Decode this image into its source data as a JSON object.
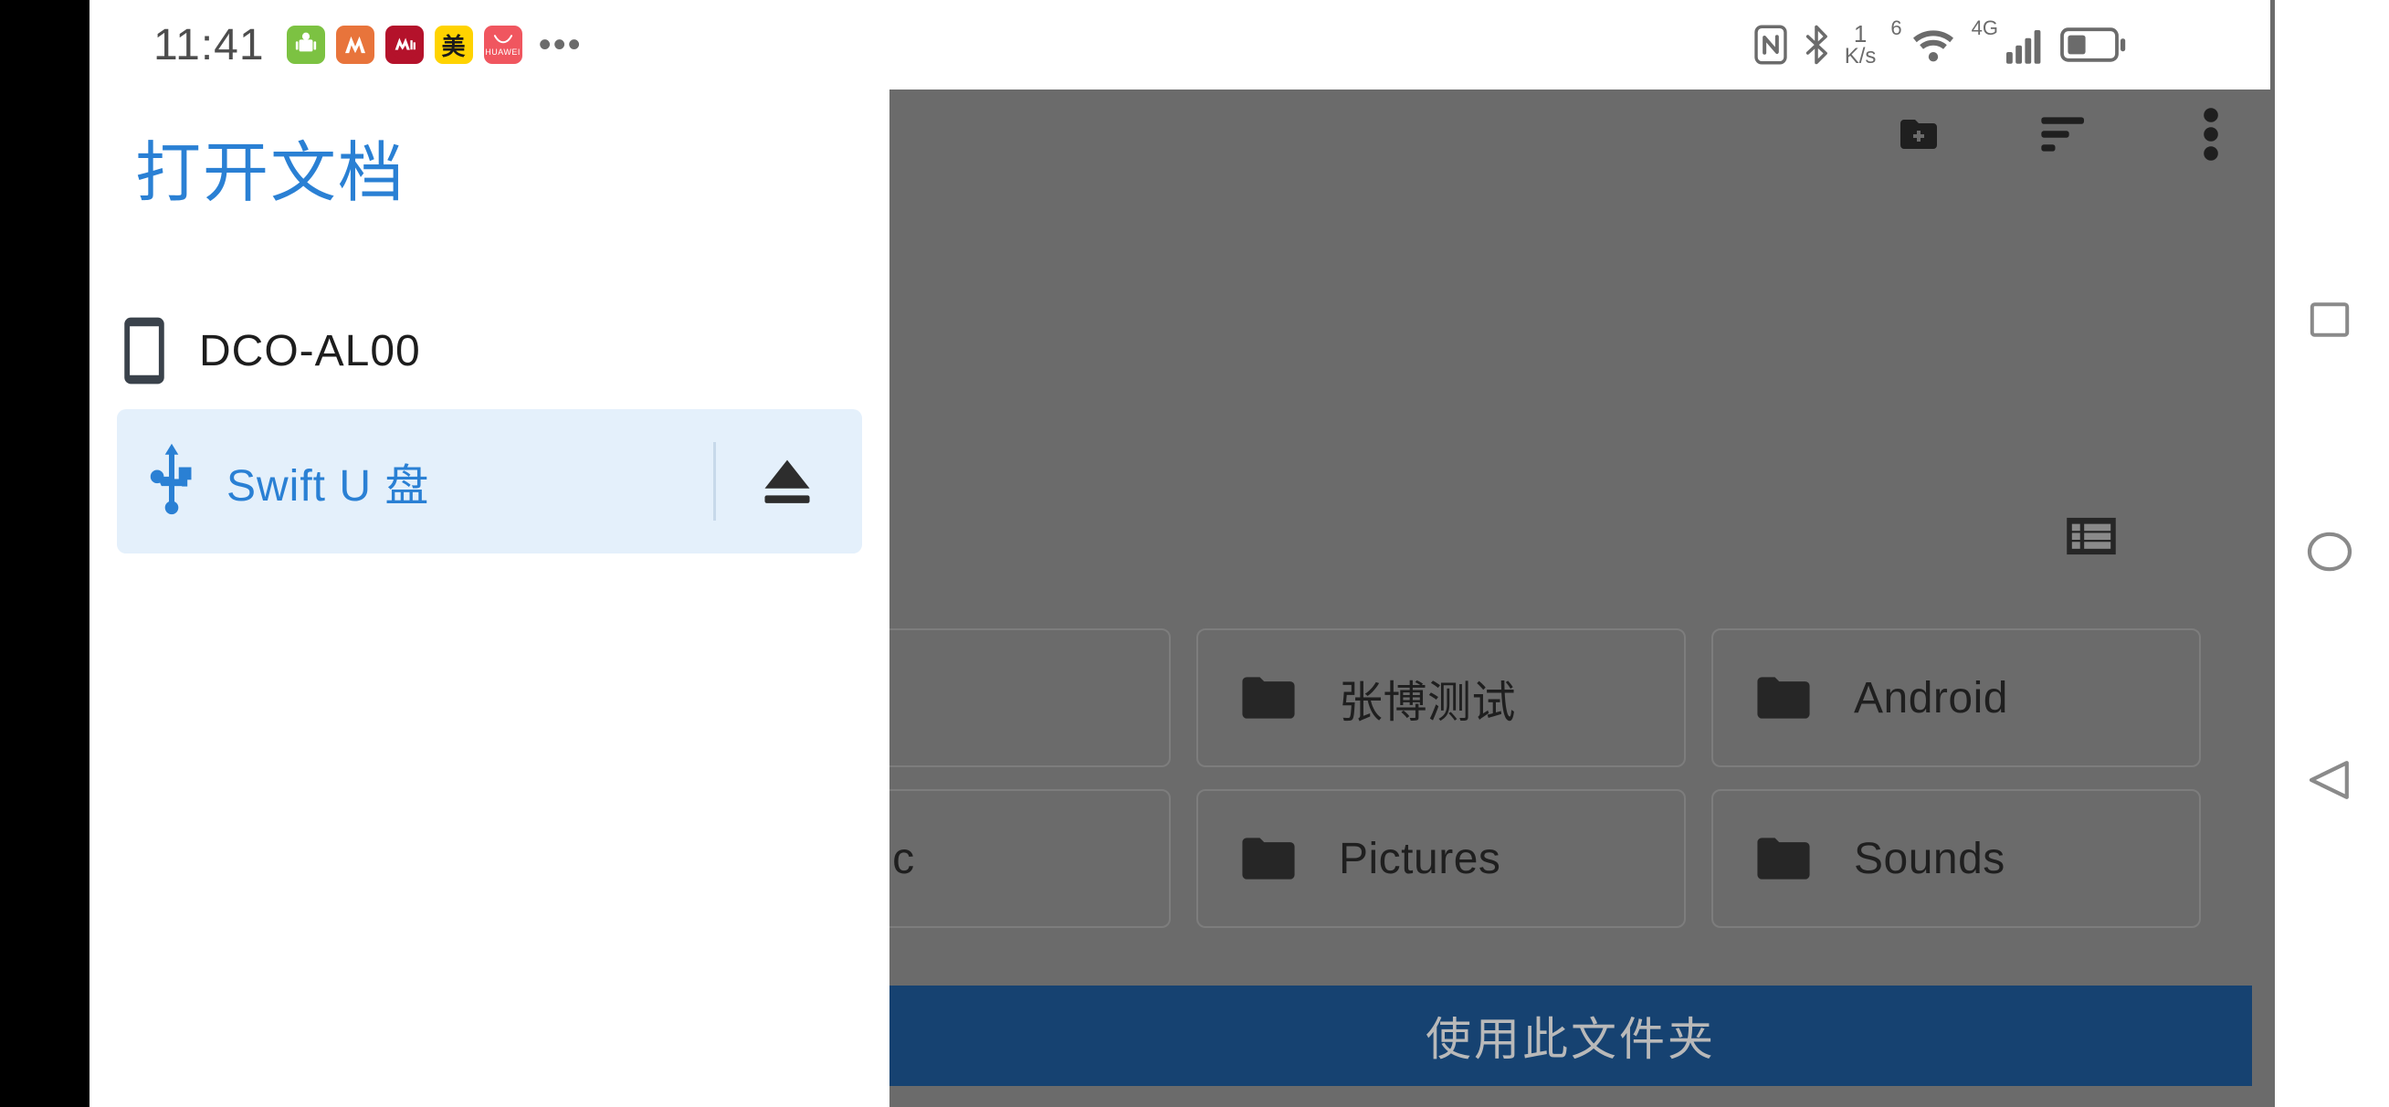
{
  "statusbar": {
    "time": "11:41",
    "app_icons": [
      {
        "name": "nas-app-icon",
        "label": "NAS"
      },
      {
        "name": "amap-app-icon",
        "label": "M"
      },
      {
        "name": "cmb-app-icon",
        "label": "M"
      },
      {
        "name": "meituan-app-icon",
        "label": "美"
      },
      {
        "name": "huawei-app-icon",
        "label": "HUAWEI"
      }
    ],
    "more_indicator": "•••",
    "nfc_icon": "nfc-icon",
    "bluetooth_icon": "bluetooth-icon",
    "net_speed_value": "1",
    "net_speed_unit": "K/s",
    "wifi_icon": "wifi-icon",
    "wifi_generation": "6",
    "mobile_network": "4G",
    "signal_icon": "cellular-signal-icon",
    "battery_icon": "battery-icon"
  },
  "drawer": {
    "title": "打开文档",
    "items": [
      {
        "label": "DCO-AL00",
        "icon": "phone-icon",
        "selected": false,
        "eject": false
      },
      {
        "label": "Swift U 盘",
        "icon": "usb-icon",
        "selected": true,
        "eject": true,
        "eject_icon": "eject-icon"
      }
    ]
  },
  "app": {
    "topbar_actions": [
      {
        "name": "new-folder-button",
        "icon": "new-folder-icon"
      },
      {
        "name": "sort-button",
        "icon": "sort-icon"
      },
      {
        "name": "overflow-menu-button",
        "icon": "more-vert-icon"
      }
    ],
    "view_toggle": {
      "name": "list-view-toggle",
      "icon": "list-view-icon"
    },
    "folders_row1": [
      {
        "label": "",
        "icon": "folder-icon",
        "truncated": true
      },
      {
        "label": "张博测试",
        "icon": "folder-icon"
      },
      {
        "label": "Android",
        "icon": "folder-icon"
      }
    ],
    "folders_row2": [
      {
        "label": "ic",
        "icon": "folder-icon",
        "truncated": true
      },
      {
        "label": "Pictures",
        "icon": "folder-icon"
      },
      {
        "label": "Sounds",
        "icon": "folder-icon"
      }
    ],
    "primary_button": "使用此文件夹"
  },
  "navbar": {
    "recents": "recents-square-icon",
    "home": "home-circle-icon",
    "back": "back-triangle-icon"
  },
  "colors": {
    "accent": "#2a80d4",
    "selected_bg": "#e4f0fb",
    "scrim": "#6b6b6b",
    "primary_button": "#164271"
  }
}
